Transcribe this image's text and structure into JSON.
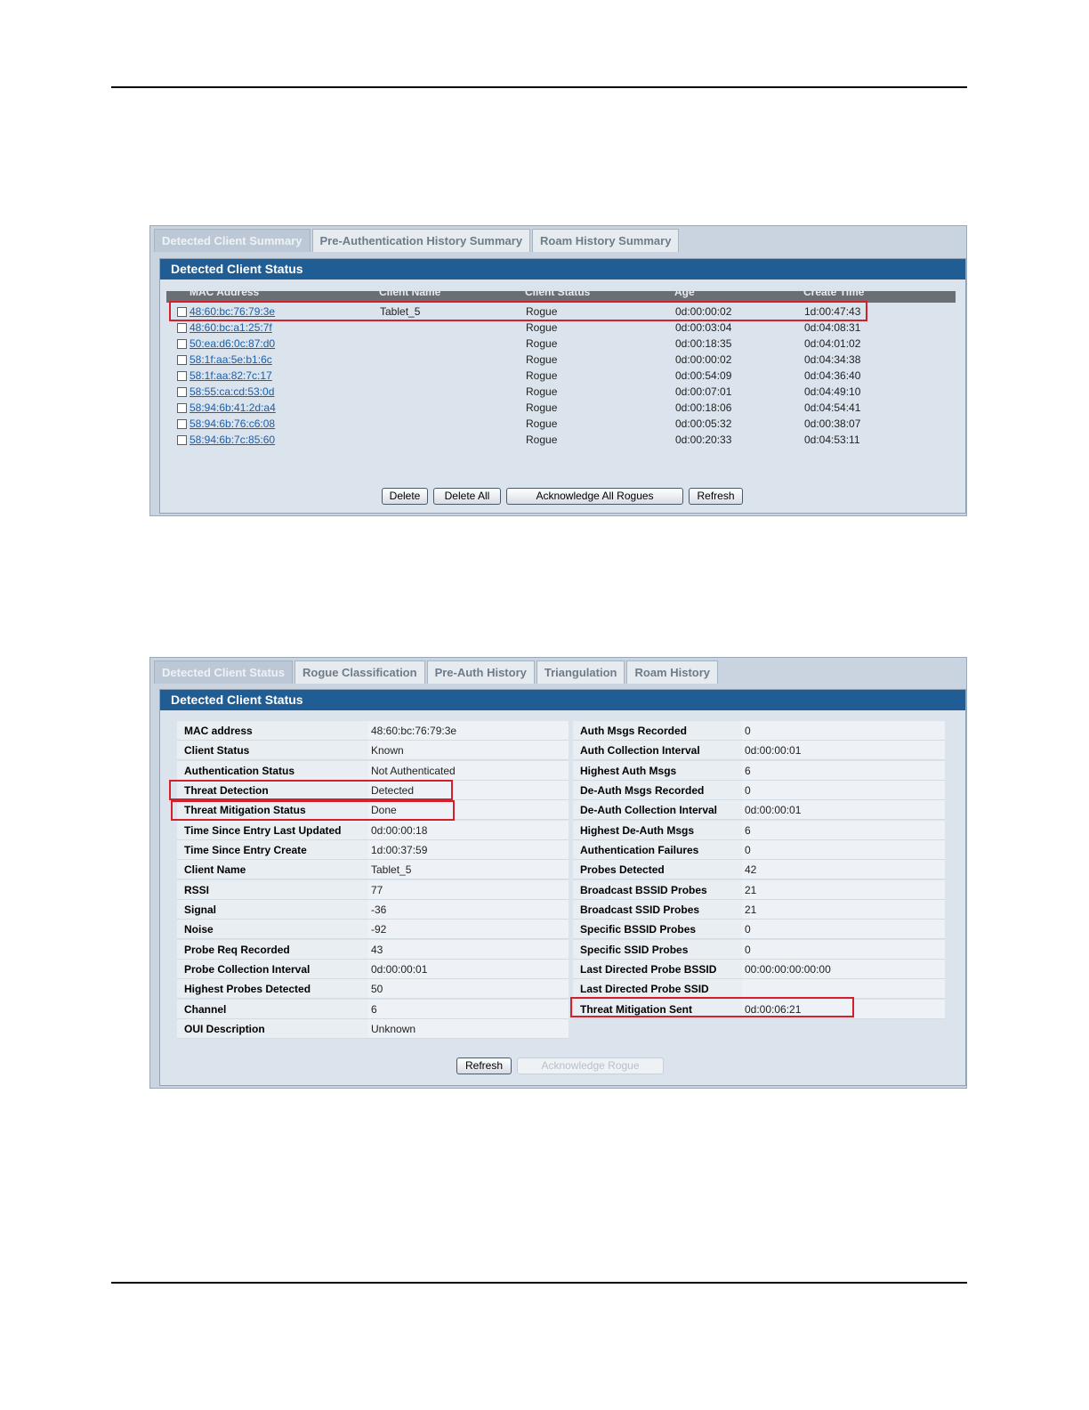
{
  "summary_panel": {
    "tabs": [
      "Detected Client Summary",
      "Pre-Authentication History Summary",
      "Roam History Summary"
    ],
    "title": "Detected Client Status",
    "columns": [
      "MAC Address",
      "Client Name",
      "Client Status",
      "Age",
      "Create Time"
    ],
    "rows": [
      {
        "mac": "48:60:bc:76:79:3e",
        "name": "Tablet_5",
        "status": "Rogue",
        "age": "0d:00:00:02",
        "create": "1d:00:47:43"
      },
      {
        "mac": "48:60:bc:a1:25:7f",
        "name": "",
        "status": "Rogue",
        "age": "0d:00:03:04",
        "create": "0d:04:08:31"
      },
      {
        "mac": "50:ea:d6:0c:87:d0",
        "name": "",
        "status": "Rogue",
        "age": "0d:00:18:35",
        "create": "0d:04:01:02"
      },
      {
        "mac": "58:1f:aa:5e:b1:6c",
        "name": "",
        "status": "Rogue",
        "age": "0d:00:00:02",
        "create": "0d:04:34:38"
      },
      {
        "mac": "58:1f:aa:82:7c:17",
        "name": "",
        "status": "Rogue",
        "age": "0d:00:54:09",
        "create": "0d:04:36:40"
      },
      {
        "mac": "58:55:ca:cd:53:0d",
        "name": "",
        "status": "Rogue",
        "age": "0d:00:07:01",
        "create": "0d:04:49:10"
      },
      {
        "mac": "58:94:6b:41:2d:a4",
        "name": "",
        "status": "Rogue",
        "age": "0d:00:18:06",
        "create": "0d:04:54:41"
      },
      {
        "mac": "58:94:6b:76:c6:08",
        "name": "",
        "status": "Rogue",
        "age": "0d:00:05:32",
        "create": "0d:00:38:07"
      },
      {
        "mac": "58:94:6b:7c:85:60",
        "name": "",
        "status": "Rogue",
        "age": "0d:00:20:33",
        "create": "0d:04:53:11"
      }
    ],
    "buttons": {
      "delete": "Delete",
      "delete_all": "Delete All",
      "ack_all": "Acknowledge All Rogues",
      "refresh": "Refresh"
    }
  },
  "detail_panel": {
    "tabs": [
      "Detected Client Status",
      "Rogue Classification",
      "Pre-Auth History",
      "Triangulation",
      "Roam History"
    ],
    "title": "Detected Client Status",
    "left": [
      {
        "label": "MAC address",
        "value": "48:60:bc:76:79:3e"
      },
      {
        "label": "Client Status",
        "value": "Known"
      },
      {
        "label": "Authentication Status",
        "value": "Not Authenticated"
      },
      {
        "label": "Threat Detection",
        "value": "Detected"
      },
      {
        "label": "Threat Mitigation Status",
        "value": "Done"
      },
      {
        "label": "Time Since Entry Last Updated",
        "value": "0d:00:00:18"
      },
      {
        "label": "Time Since Entry Create",
        "value": "1d:00:37:59"
      },
      {
        "label": "Client Name",
        "value": "Tablet_5"
      },
      {
        "label": "RSSI",
        "value": "77"
      },
      {
        "label": "Signal",
        "value": "-36"
      },
      {
        "label": "Noise",
        "value": "-92"
      },
      {
        "label": "Probe Req Recorded",
        "value": "43"
      },
      {
        "label": "Probe Collection Interval",
        "value": "0d:00:00:01"
      },
      {
        "label": "Highest Probes Detected",
        "value": "50"
      },
      {
        "label": "Channel",
        "value": "6"
      },
      {
        "label": "OUI Description",
        "value": "Unknown"
      }
    ],
    "right": [
      {
        "label": "Auth Msgs Recorded",
        "value": "0"
      },
      {
        "label": "Auth Collection Interval",
        "value": "0d:00:00:01"
      },
      {
        "label": "Highest Auth Msgs",
        "value": "6"
      },
      {
        "label": "De-Auth Msgs Recorded",
        "value": "0"
      },
      {
        "label": "De-Auth Collection Interval",
        "value": "0d:00:00:01"
      },
      {
        "label": "Highest De-Auth Msgs",
        "value": "6"
      },
      {
        "label": "Authentication Failures",
        "value": "0"
      },
      {
        "label": "Probes Detected",
        "value": "42"
      },
      {
        "label": "Broadcast BSSID Probes",
        "value": "21"
      },
      {
        "label": "Broadcast SSID Probes",
        "value": "21"
      },
      {
        "label": "Specific BSSID Probes",
        "value": "0"
      },
      {
        "label": "Specific SSID Probes",
        "value": "0"
      },
      {
        "label": "Last Directed Probe BSSID",
        "value": "00:00:00:00:00:00"
      },
      {
        "label": "Last Directed Probe SSID",
        "value": ""
      },
      {
        "label": "Threat Mitigation Sent",
        "value": "0d:00:06:21"
      }
    ],
    "buttons": {
      "refresh": "Refresh",
      "ack_rogue": "Acknowledge Rogue"
    }
  }
}
